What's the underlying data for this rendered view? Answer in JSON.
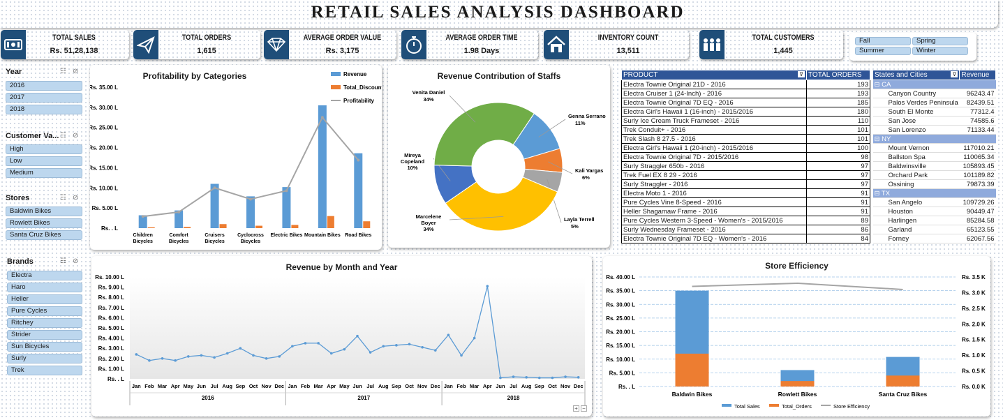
{
  "title": "RETAIL SALES ANALYSIS DASHBOARD",
  "kpis": [
    {
      "label": "TOTAL SALES",
      "value": "Rs. 51,28,138",
      "icon": "money-icon"
    },
    {
      "label": "TOTAL ORDERS",
      "value": "1,615",
      "icon": "paper-plane-icon"
    },
    {
      "label": "AVERAGE ORDER VALUE",
      "value": "Rs. 3,175",
      "icon": "diamond-icon"
    },
    {
      "label": "AVERAGE ORDER TIME",
      "value": "1.98 Days",
      "icon": "stopwatch-icon"
    },
    {
      "label": "INVENTORY COUNT",
      "value": "13,511",
      "icon": "house-icon"
    },
    {
      "label": "TOTAL CUSTOMERS",
      "value": "1,445",
      "icon": "people-icon"
    }
  ],
  "seasons": [
    "Fall",
    "Spring",
    "Summer",
    "Winter"
  ],
  "slicers": {
    "year": {
      "title": "Year",
      "items": [
        "2016",
        "2017",
        "2018"
      ]
    },
    "customer": {
      "title": "Customer Va...",
      "items": [
        "High",
        "Low",
        "Medium"
      ]
    },
    "stores": {
      "title": "Stores",
      "items": [
        "Baldwin Bikes",
        "Rowlett Bikes",
        "Santa Cruz Bikes"
      ]
    },
    "brands": {
      "title": "Brands",
      "items": [
        "Electra",
        "Haro",
        "Heller",
        "Pure Cycles",
        "Ritchey",
        "Strider",
        "Sun Bicycles",
        "Surly",
        "Trek"
      ]
    }
  },
  "colors": {
    "blue": "#5b9bd5",
    "orange": "#ed7d31",
    "gray": "#a5a5a5",
    "navy": "#1f4e79",
    "green": "#70ad47",
    "yellow": "#ffc000",
    "darkblue": "#4472c4"
  },
  "products": {
    "headers": [
      "PRODUCT",
      "TOTAL ORDERS"
    ],
    "rows": [
      [
        "Electra Townie Original 21D - 2016",
        "193"
      ],
      [
        "Electra Cruiser 1 (24-Inch) - 2016",
        "193"
      ],
      [
        "Electra Townie Original 7D EQ - 2016",
        "185"
      ],
      [
        "Electra Girl's Hawaii 1 (16-inch) - 2015/2016",
        "180"
      ],
      [
        "Surly Ice Cream Truck Frameset - 2016",
        "110"
      ],
      [
        "Trek Conduit+ - 2016",
        "101"
      ],
      [
        "Trek Slash 8 27.5 - 2016",
        "101"
      ],
      [
        "Electra Girl's Hawaii 1 (20-inch) - 2015/2016",
        "100"
      ],
      [
        "Electra Townie Original 7D - 2015/2016",
        "98"
      ],
      [
        "Surly Straggler 650b - 2016",
        "97"
      ],
      [
        "Trek Fuel EX 8 29 - 2016",
        "97"
      ],
      [
        "Surly Straggler - 2016",
        "97"
      ],
      [
        "Electra Moto 1 - 2016",
        "91"
      ],
      [
        "Pure Cycles Vine 8-Speed - 2016",
        "91"
      ],
      [
        "Heller Shagamaw Frame - 2016",
        "91"
      ],
      [
        "Pure Cycles Western 3-Speed - Women's - 2015/2016",
        "89"
      ],
      [
        "Surly Wednesday Frameset - 2016",
        "86"
      ],
      [
        "Electra Townie Original 7D EQ - Women's - 2016",
        "84"
      ]
    ]
  },
  "states": {
    "headers": [
      "States and Cities",
      "Revenue"
    ],
    "rows": [
      {
        "group": "⊟ CA"
      },
      {
        "city": "Canyon Country",
        "rev": "96243.47"
      },
      {
        "city": "Palos Verdes Peninsula",
        "rev": "82439.51"
      },
      {
        "city": "South El Monte",
        "rev": "77312.4"
      },
      {
        "city": "San Jose",
        "rev": "74585.6"
      },
      {
        "city": "San Lorenzo",
        "rev": "71133.44"
      },
      {
        "group": "⊟ NY"
      },
      {
        "city": "Mount Vernon",
        "rev": "117010.21"
      },
      {
        "city": "Ballston Spa",
        "rev": "110065.34"
      },
      {
        "city": "Baldwinsville",
        "rev": "105893.45"
      },
      {
        "city": "Orchard Park",
        "rev": "101189.82"
      },
      {
        "city": "Ossining",
        "rev": "79873.39"
      },
      {
        "group": "⊟ TX"
      },
      {
        "city": "San Angelo",
        "rev": "109729.26"
      },
      {
        "city": "Houston",
        "rev": "90449.47"
      },
      {
        "city": "Harlingen",
        "rev": "85284.58"
      },
      {
        "city": "Garland",
        "rev": "65123.55"
      },
      {
        "city": "Forney",
        "rev": "62067.56"
      }
    ]
  },
  "chart_data": [
    {
      "type": "bar",
      "title": "Profitability by Categories",
      "categories": [
        "Children Bicycles",
        "Comfort Bicycles",
        "Cruisers Bicycles",
        "Cyclocross Bicycles",
        "Electric Bikes",
        "Mountain Bikes",
        "Road Bikes"
      ],
      "series": [
        {
          "name": "Revenue",
          "values": [
            3.2,
            4.4,
            11.0,
            7.9,
            10.2,
            30.5,
            18.6
          ]
        },
        {
          "name": "Total_Discount",
          "values": [
            0.2,
            0.3,
            1.0,
            0.6,
            0.8,
            3.0,
            1.7
          ]
        },
        {
          "name": "Profitability",
          "values": [
            2.9,
            4.0,
            10.0,
            7.2,
            9.3,
            27.5,
            16.9
          ]
        }
      ],
      "yticks": [
        "Rs. . L",
        "Rs. 5.00 L",
        "Rs. 10.00 L",
        "Rs. 15.00 L",
        "Rs. 20.00 L",
        "Rs. 25.00 L",
        "Rs. 30.00 L",
        "Rs. 35.00 L"
      ],
      "ylim": [
        0,
        35
      ]
    },
    {
      "type": "pie",
      "title": "Revenue Contribution of Staffs",
      "slices": [
        {
          "name": "Genna Serrano",
          "label": "Genna Serrano",
          "pct": "11%",
          "value": 11
        },
        {
          "name": "Kali Vargas",
          "label": "Kali Vargas",
          "pct": "6%",
          "value": 6
        },
        {
          "name": "Layla Terrell",
          "label": "Layla Terrell",
          "pct": "5%",
          "value": 5
        },
        {
          "name": "Marcelene Boyer",
          "label": "Marcelene Boyer",
          "pct": "34%",
          "value": 34
        },
        {
          "name": "Mireya Copeland",
          "label": "Mireya Copeland",
          "pct": "10%",
          "value": 10
        },
        {
          "name": "Venita Daniel",
          "label": "Venita Daniel",
          "pct": "34%",
          "value": 34
        }
      ]
    },
    {
      "type": "line",
      "title": "Revenue by Month and Year",
      "months": [
        "Jan",
        "Feb",
        "Mar",
        "Apr",
        "May",
        "Jun",
        "Jul",
        "Aug",
        "Sep",
        "Oct",
        "Nov",
        "Dec",
        "Jan",
        "Feb",
        "Mar",
        "Apr",
        "May",
        "Jun",
        "Jul",
        "Aug",
        "Sep",
        "Oct",
        "Nov",
        "Dec",
        "Jan",
        "Feb",
        "Mar",
        "Apr",
        "Jun",
        "Jul",
        "Aug",
        "Sep",
        "Oct",
        "Nov",
        "Dec"
      ],
      "years": [
        "2016",
        "2017",
        "2018"
      ],
      "values": [
        2.4,
        1.8,
        2.0,
        1.8,
        2.2,
        2.3,
        2.1,
        2.5,
        3.0,
        2.3,
        2.0,
        2.2,
        3.2,
        3.5,
        3.5,
        2.5,
        2.9,
        4.2,
        2.6,
        3.2,
        3.3,
        3.4,
        3.1,
        2.8,
        4.3,
        2.3,
        4.0,
        9.1,
        0.1,
        0.2,
        0.15,
        0.1,
        0.1,
        0.2,
        0.15
      ],
      "yticks": [
        "Rs. . L",
        "Rs. 1.00 L",
        "Rs. 2.00 L",
        "Rs. 3.00 L",
        "Rs. 4.00 L",
        "Rs. 5.00 L",
        "Rs. 6.00 L",
        "Rs. 7.00 L",
        "Rs. 8.00 L",
        "Rs. 9.00 L",
        "Rs. 10.00 L"
      ],
      "ylim": [
        0,
        10
      ]
    },
    {
      "type": "bar",
      "title": "Store Efficiency",
      "categories": [
        "Baldwin Bikes",
        "Rowlett Bikes",
        "Santa Cruz Bikes"
      ],
      "series": [
        {
          "name": "Total Sales",
          "values": [
            35.0,
            6.0,
            10.8
          ]
        },
        {
          "name": "Total_Orders",
          "values": [
            1.2,
            0.2,
            0.4
          ]
        },
        {
          "name": "Store Efficiency",
          "values": [
            3.2,
            3.3,
            3.1
          ]
        }
      ],
      "yticks_left": [
        "Rs. . L",
        "Rs. 5.00 L",
        "Rs. 10.00 L",
        "Rs. 15.00 L",
        "Rs. 20.00 L",
        "Rs. 25.00 L",
        "Rs. 30.00 L",
        "Rs. 35.00 L",
        "Rs. 40.00 L"
      ],
      "yticks_right": [
        "Rs. 0.0 K",
        "Rs. 0.5 K",
        "Rs. 1.0 K",
        "Rs. 1.5 K",
        "Rs. 2.0 K",
        "Rs. 2.5 K",
        "Rs. 3.0 K",
        "Rs. 3.5 K"
      ],
      "ylim_left": [
        0,
        40
      ],
      "ylim_right": [
        0,
        3.5
      ]
    }
  ]
}
